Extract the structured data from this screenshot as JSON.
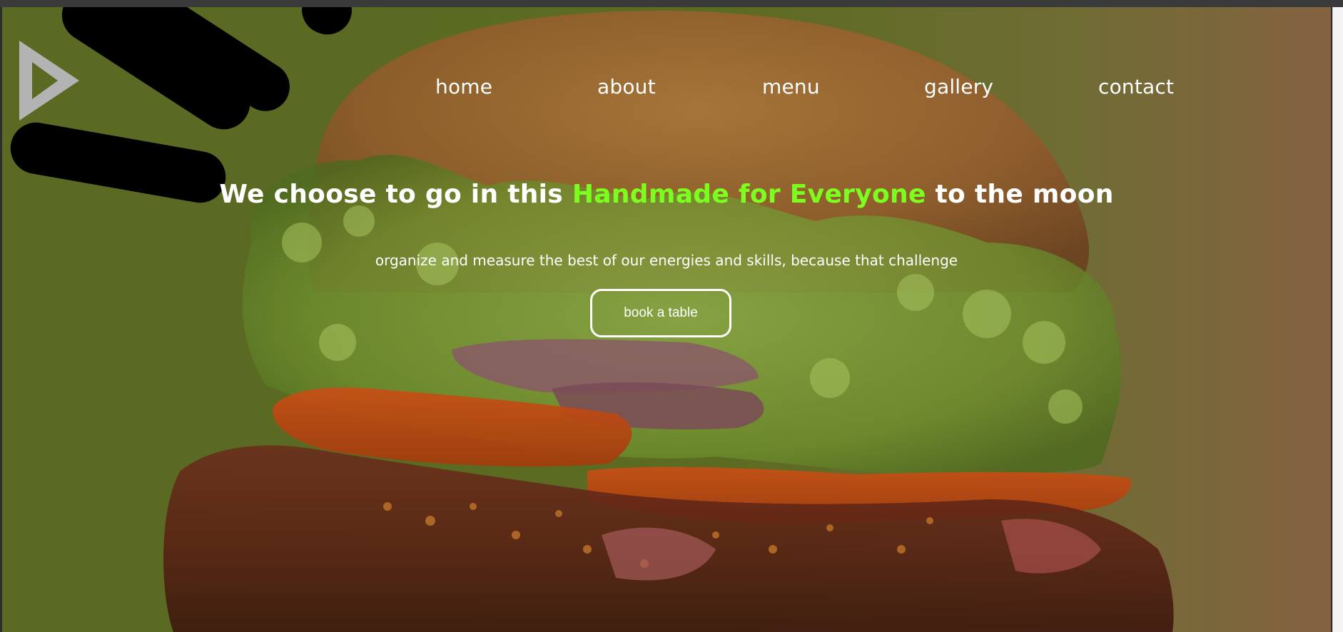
{
  "nav": {
    "items": [
      {
        "label": "home"
      },
      {
        "label": "about"
      },
      {
        "label": "menu"
      },
      {
        "label": "gallery"
      },
      {
        "label": "contact"
      }
    ]
  },
  "hero": {
    "headline_pre": "We choose to go in this ",
    "headline_accent": "Handmade for Everyone",
    "headline_post": " to the moon",
    "subline": "organize and measure the best of our energies and skills, because that challenge",
    "cta_label": "book a table"
  },
  "colors": {
    "accent": "#7cff1f",
    "background_left": "#5a6a22",
    "background_right": "#846241",
    "text": "#ffffff"
  },
  "icons": {
    "logo": "play-triangle-icon"
  }
}
